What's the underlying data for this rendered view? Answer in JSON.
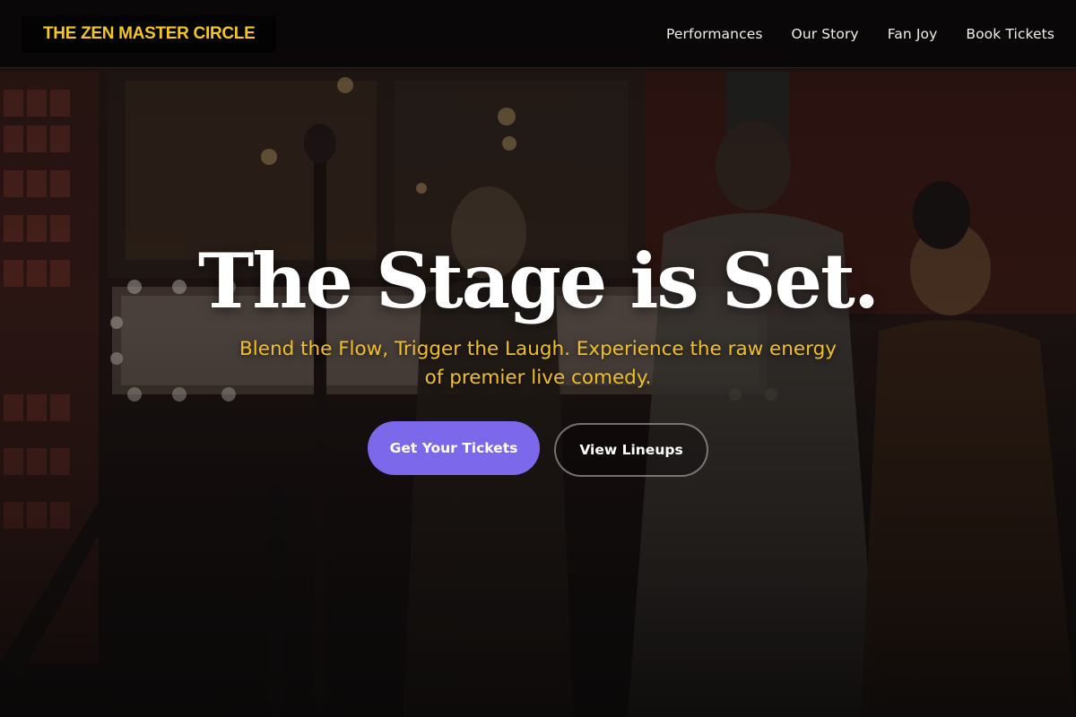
{
  "brand": {
    "name": "THE ZEN MASTER CIRCLE"
  },
  "nav": {
    "items": [
      {
        "label": "Performances"
      },
      {
        "label": "Our Story"
      },
      {
        "label": "Fan Joy"
      },
      {
        "label": "Book Tickets"
      }
    ]
  },
  "hero": {
    "title": "The Stage is Set.",
    "subtitle": "Blend the Flow, Trigger the Laugh. Experience the raw energy of premier live comedy.",
    "primary_cta": "Get Your Tickets",
    "secondary_cta": "View Lineups"
  },
  "colors": {
    "brand_accent": "#f3c623",
    "subtitle_text": "#f0bf26",
    "primary_button": "#7b68ea",
    "navbar_bg": "#080606"
  }
}
